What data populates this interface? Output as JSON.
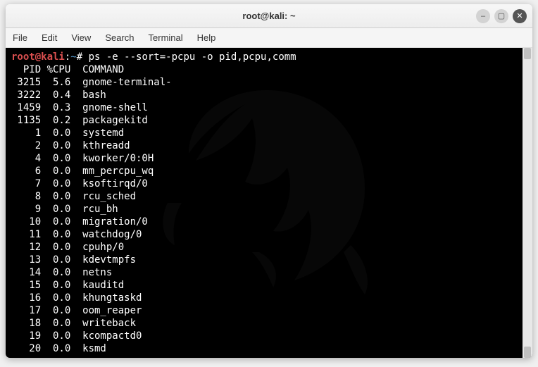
{
  "titlebar": {
    "title": "root@kali: ~"
  },
  "win_controls": {
    "minimize_glyph": "–",
    "maximize_glyph": "▢",
    "close_glyph": "✕"
  },
  "menubar": [
    "File",
    "Edit",
    "View",
    "Search",
    "Terminal",
    "Help"
  ],
  "prompt": {
    "user_host": "root@kali",
    "colon": ":",
    "path": "~",
    "hash": "# ",
    "command": "ps -e --sort=-pcpu -o pid,pcpu,comm"
  },
  "columns": {
    "pid": "  PID",
    "pcpu": "%CPU",
    "command": "COMMAND"
  },
  "processes": [
    {
      "pid": "3215",
      "pcpu": "5.6",
      "comm": "gnome-terminal-"
    },
    {
      "pid": "3222",
      "pcpu": "0.4",
      "comm": "bash"
    },
    {
      "pid": "1459",
      "pcpu": "0.3",
      "comm": "gnome-shell"
    },
    {
      "pid": "1135",
      "pcpu": "0.2",
      "comm": "packagekitd"
    },
    {
      "pid": "1",
      "pcpu": "0.0",
      "comm": "systemd"
    },
    {
      "pid": "2",
      "pcpu": "0.0",
      "comm": "kthreadd"
    },
    {
      "pid": "4",
      "pcpu": "0.0",
      "comm": "kworker/0:0H"
    },
    {
      "pid": "6",
      "pcpu": "0.0",
      "comm": "mm_percpu_wq"
    },
    {
      "pid": "7",
      "pcpu": "0.0",
      "comm": "ksoftirqd/0"
    },
    {
      "pid": "8",
      "pcpu": "0.0",
      "comm": "rcu_sched"
    },
    {
      "pid": "9",
      "pcpu": "0.0",
      "comm": "rcu_bh"
    },
    {
      "pid": "10",
      "pcpu": "0.0",
      "comm": "migration/0"
    },
    {
      "pid": "11",
      "pcpu": "0.0",
      "comm": "watchdog/0"
    },
    {
      "pid": "12",
      "pcpu": "0.0",
      "comm": "cpuhp/0"
    },
    {
      "pid": "13",
      "pcpu": "0.0",
      "comm": "kdevtmpfs"
    },
    {
      "pid": "14",
      "pcpu": "0.0",
      "comm": "netns"
    },
    {
      "pid": "15",
      "pcpu": "0.0",
      "comm": "kauditd"
    },
    {
      "pid": "16",
      "pcpu": "0.0",
      "comm": "khungtaskd"
    },
    {
      "pid": "17",
      "pcpu": "0.0",
      "comm": "oom_reaper"
    },
    {
      "pid": "18",
      "pcpu": "0.0",
      "comm": "writeback"
    },
    {
      "pid": "19",
      "pcpu": "0.0",
      "comm": "kcompactd0"
    },
    {
      "pid": "20",
      "pcpu": "0.0",
      "comm": "ksmd"
    }
  ]
}
